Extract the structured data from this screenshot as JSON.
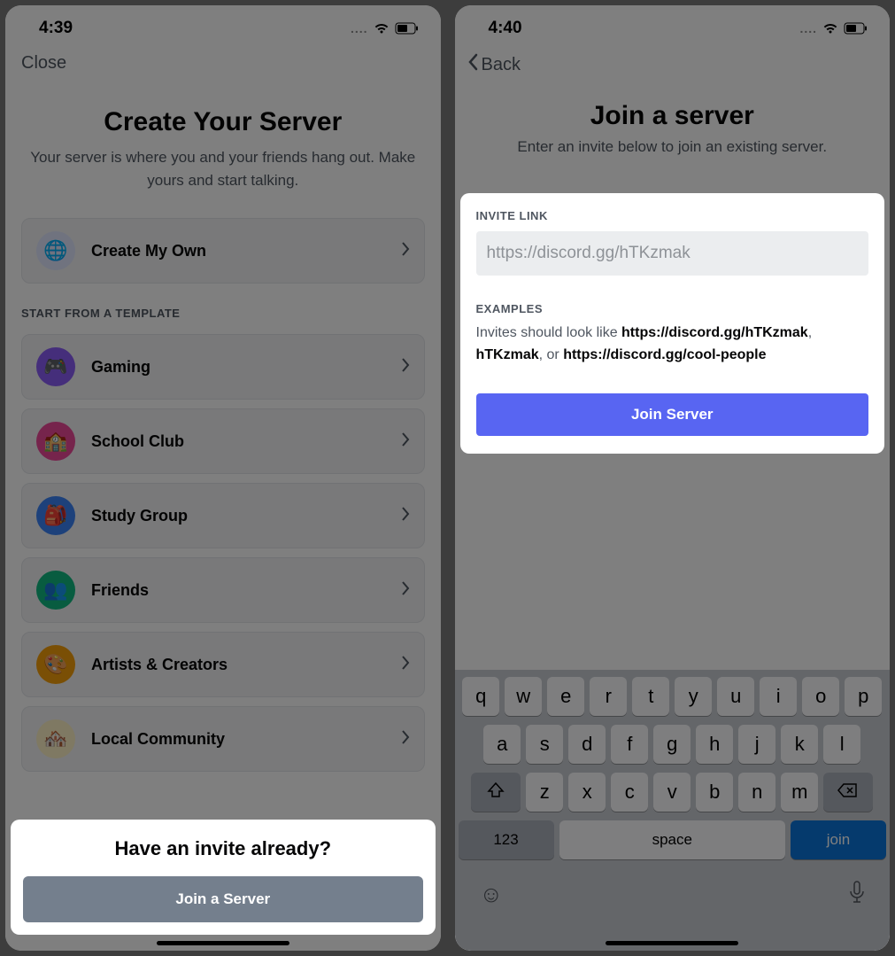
{
  "screen1": {
    "status": {
      "time": "4:39",
      "dots": "...."
    },
    "close": "Close",
    "title": "Create Your Server",
    "subtitle": "Your server is where you and your friends hang out. Make yours and start talking.",
    "create_own": "Create My Own",
    "template_header": "START FROM A TEMPLATE",
    "templates": [
      {
        "label": "Gaming",
        "bg": "#8b5cf6"
      },
      {
        "label": "School Club",
        "bg": "#ec4899"
      },
      {
        "label": "Study Group",
        "bg": "#3b82f6"
      },
      {
        "label": "Friends",
        "bg": "#10b981"
      },
      {
        "label": "Artists & Creators",
        "bg": "#f59e0b"
      },
      {
        "label": "Local Community",
        "bg": "#fbbf24"
      }
    ],
    "invite_prompt": "Have an invite already?",
    "join_button": "Join a Server"
  },
  "screen2": {
    "status": {
      "time": "4:40",
      "dots": "...."
    },
    "back": "Back",
    "title": "Join a server",
    "subtitle": "Enter an invite below to join an existing server.",
    "invite_label": "INVITE LINK",
    "invite_placeholder": "https://discord.gg/hTKzmak",
    "examples_label": "EXAMPLES",
    "examples_prefix": "Invites should look like ",
    "examples_ex1": "https://discord.gg/hTKzmak",
    "examples_mid1": ", ",
    "examples_ex2": "hTKzmak",
    "examples_mid2": ", or ",
    "examples_ex3": "https://discord.gg/cool-people",
    "join_button": "Join Server",
    "keyboard": {
      "row1": [
        "q",
        "w",
        "e",
        "r",
        "t",
        "y",
        "u",
        "i",
        "o",
        "p"
      ],
      "row2": [
        "a",
        "s",
        "d",
        "f",
        "g",
        "h",
        "j",
        "k",
        "l"
      ],
      "row3": [
        "z",
        "x",
        "c",
        "v",
        "b",
        "n",
        "m"
      ],
      "numbers": "123",
      "space": "space",
      "action": "join"
    }
  }
}
